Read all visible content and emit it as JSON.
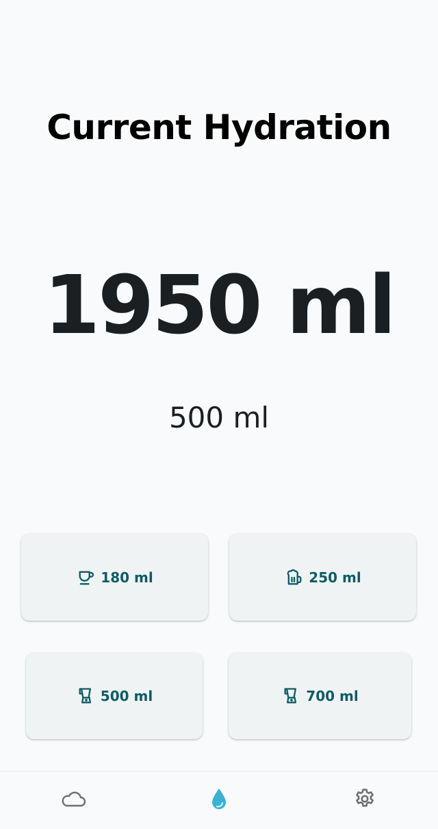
{
  "title": "Current Hydration",
  "total": "1950 ml",
  "selected_amount": "500 ml",
  "quick_add": [
    {
      "label": "180 ml",
      "icon": "coffee-cup-icon"
    },
    {
      "label": "250 ml",
      "icon": "beer-mug-icon"
    },
    {
      "label": "500 ml",
      "icon": "blender-icon"
    },
    {
      "label": "700 ml",
      "icon": "blender-icon"
    }
  ],
  "nav": {
    "items": [
      {
        "name": "weather",
        "icon": "cloud-icon",
        "active": false
      },
      {
        "name": "hydration",
        "icon": "water-drop-icon",
        "active": true
      },
      {
        "name": "settings",
        "icon": "gear-icon",
        "active": false
      }
    ]
  },
  "colors": {
    "background": "#f8fafc",
    "button_bg": "#eff3f4",
    "button_text": "#0f5b66",
    "active_nav": "#3bb2d3",
    "inactive_nav": "#6b6f73",
    "text_dark": "#1b1f22"
  }
}
